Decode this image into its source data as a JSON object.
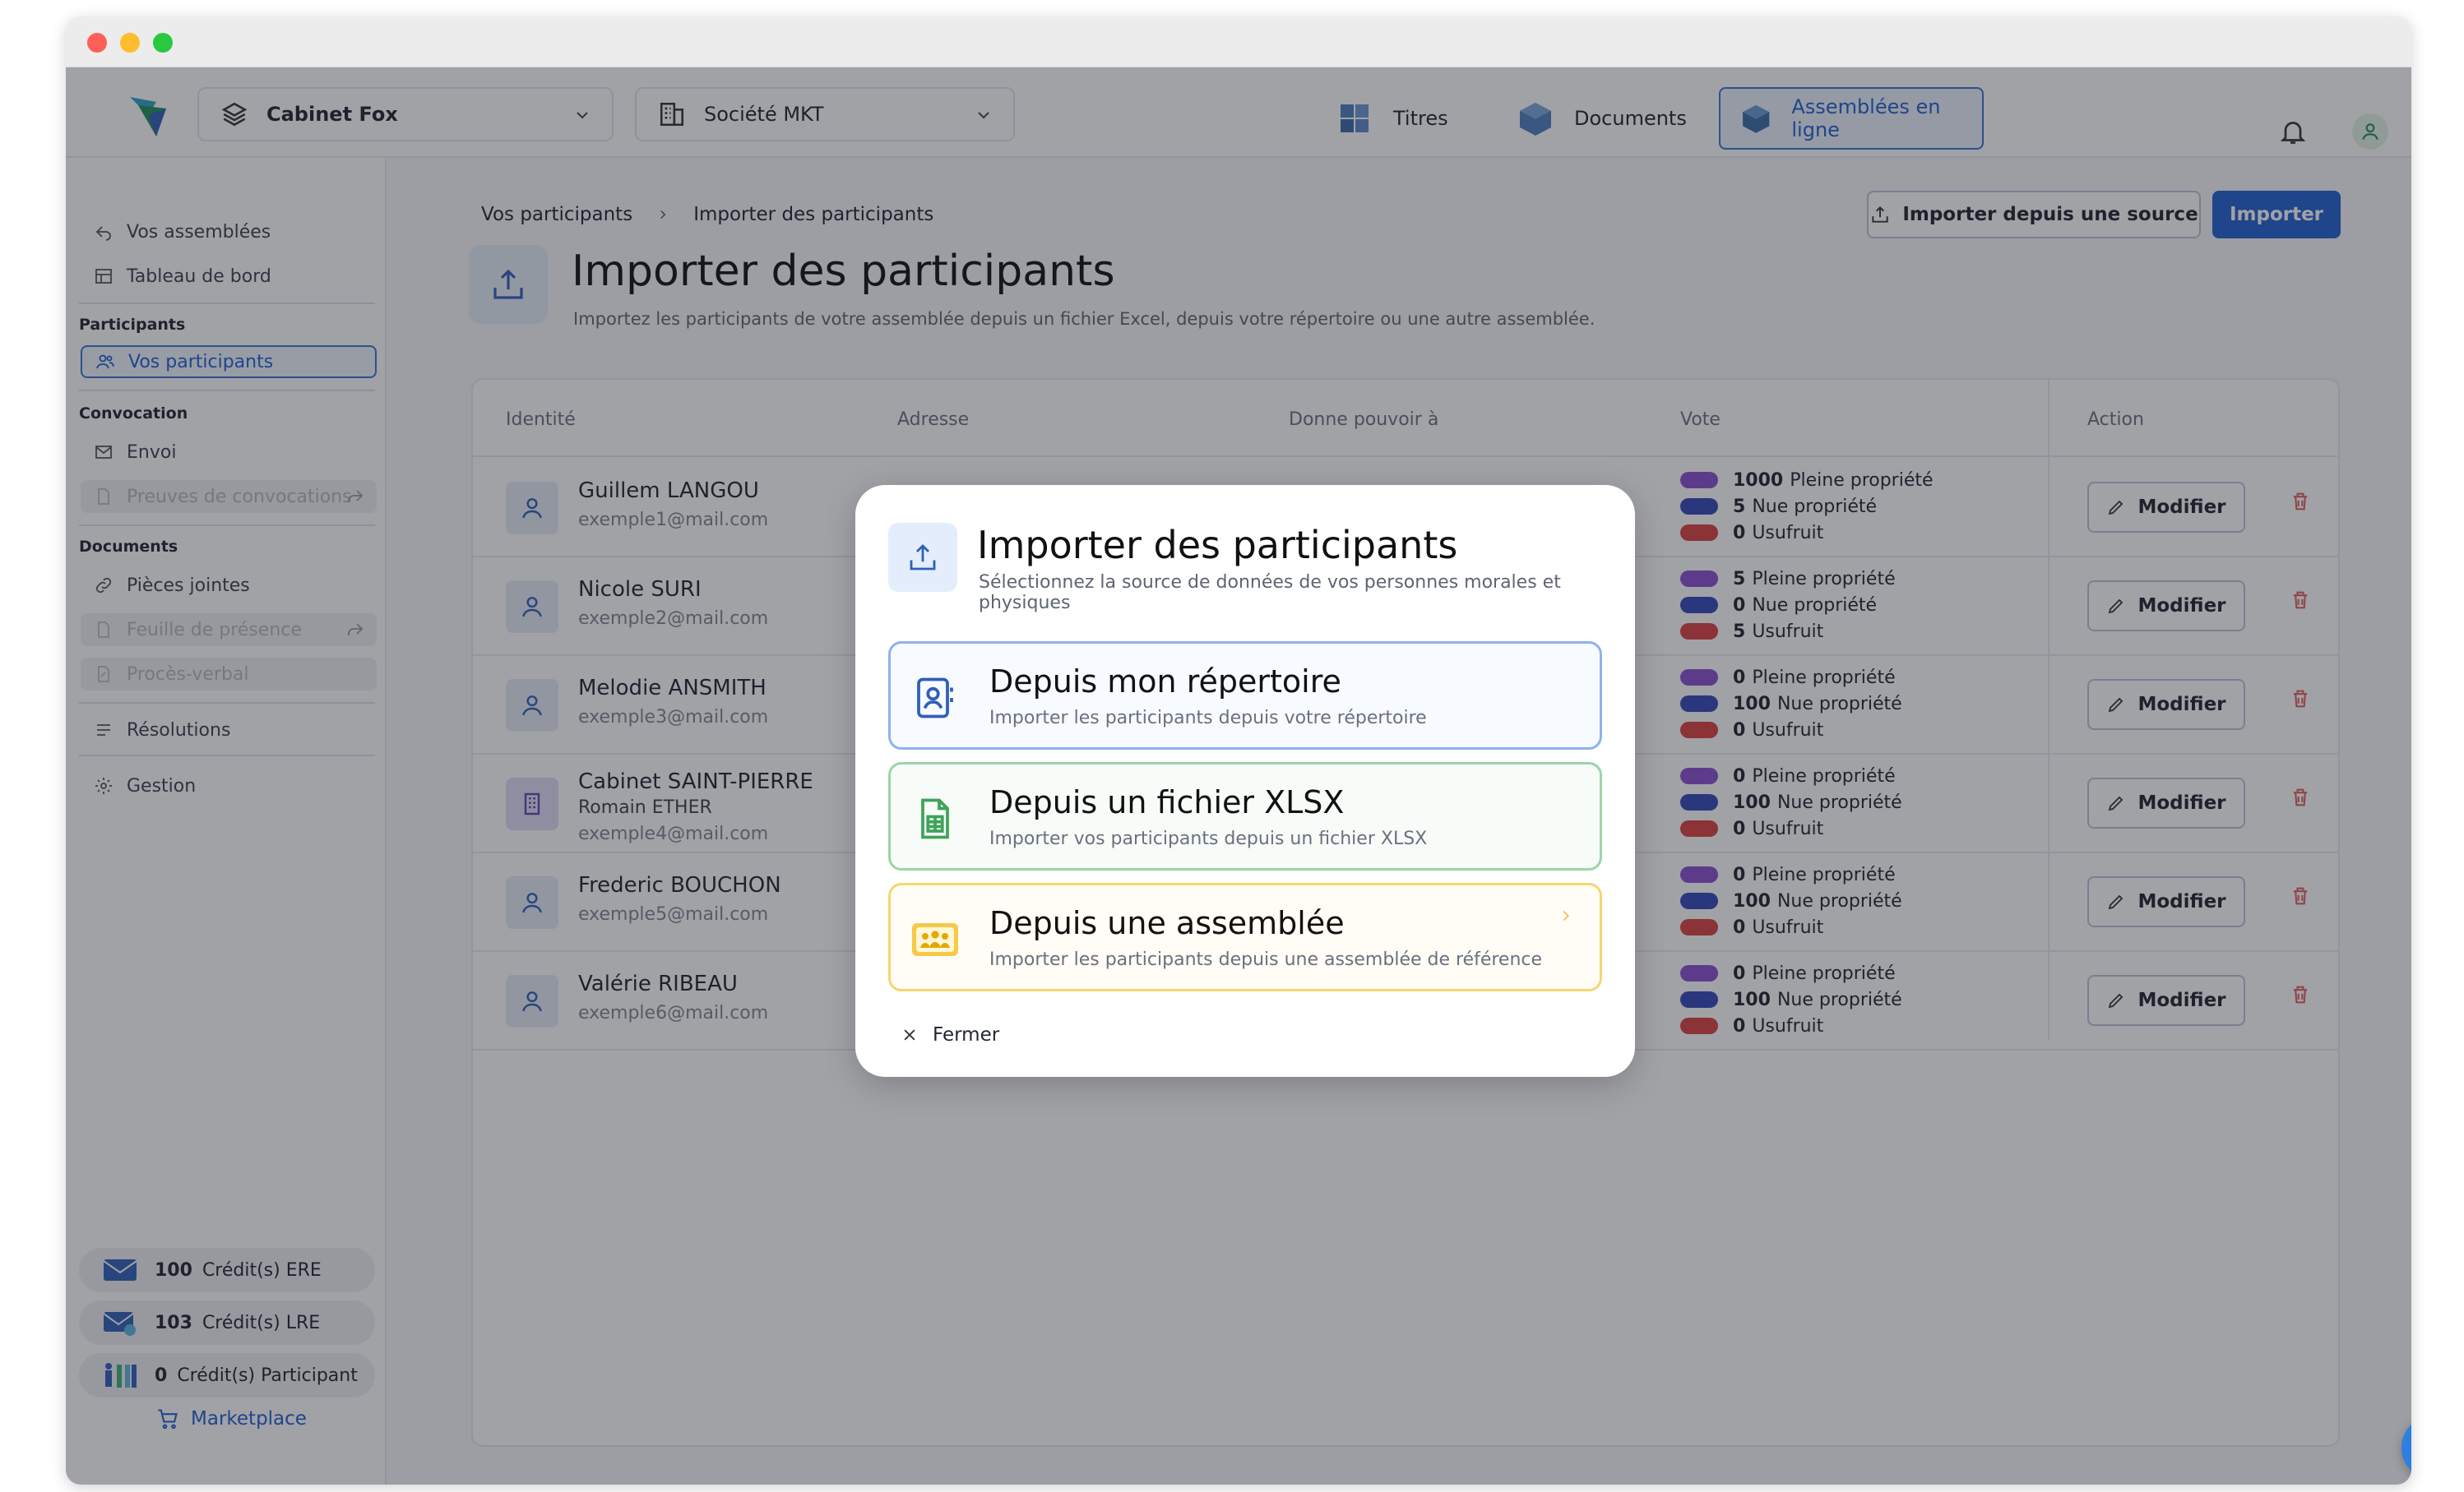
{
  "header": {
    "cabinet_selector": "Cabinet Fox",
    "societe_selector": "Société MKT",
    "nav": [
      {
        "label": "Titres"
      },
      {
        "label": "Documents"
      },
      {
        "label": "Assemblées en ligne",
        "active": true
      }
    ]
  },
  "sidebar": {
    "top_items": [
      "Vos assemblées",
      "Tableau de bord"
    ],
    "sections": [
      {
        "title": "Participants",
        "items": [
          "Vos participants"
        ]
      },
      {
        "title": "Convocation",
        "items": [
          "Envoi",
          "Preuves de convocations"
        ]
      },
      {
        "title": "Documents",
        "items": [
          "Pièces jointes",
          "Feuille de présence",
          "Procès-verbal"
        ]
      }
    ],
    "bottom_items": [
      "Résolutions",
      "Gestion"
    ],
    "credits": [
      {
        "count": "100",
        "label": "Crédit(s) ERE"
      },
      {
        "count": "103",
        "label": "Crédit(s) LRE"
      },
      {
        "count": "0",
        "label": "Crédit(s) Participant"
      }
    ],
    "marketplace": "Marketplace"
  },
  "breadcrumb": {
    "parent": "Vos participants",
    "current": "Importer des participants"
  },
  "page": {
    "title": "Importer des participants",
    "subtitle": "Importez les participants de votre assemblée depuis un fichier Excel, depuis votre répertoire ou une autre assemblée.",
    "btn_source": "Importer depuis une source",
    "btn_import": "Importer"
  },
  "table": {
    "columns": [
      "Identité",
      "Adresse",
      "Donne pouvoir à",
      "Vote",
      "Action"
    ],
    "action_label": "Modifier",
    "vote_labels": [
      "Pleine propriété",
      "Nue propriété",
      "Usufruit"
    ],
    "rows": [
      {
        "name": "Guillem LANGOU",
        "sub": "",
        "email": "exemple1@mail.com",
        "votes": [
          "1000",
          "5",
          "0"
        ]
      },
      {
        "name": "Nicole SURI",
        "sub": "",
        "email": "exemple2@mail.com",
        "votes": [
          "5",
          "0",
          "5"
        ]
      },
      {
        "name": "Melodie ANSMITH",
        "sub": "",
        "email": "exemple3@mail.com",
        "votes": [
          "0",
          "100",
          "0"
        ]
      },
      {
        "name": "Cabinet SAINT-PIERRE",
        "sub": "Romain ETHER",
        "email": "exemple4@mail.com",
        "votes": [
          "0",
          "100",
          "0"
        ]
      },
      {
        "name": "Frederic BOUCHON",
        "sub": "",
        "email": "exemple5@mail.com",
        "votes": [
          "0",
          "100",
          "0"
        ]
      },
      {
        "name": "Valérie RIBEAU",
        "sub": "",
        "email": "exemple6@mail.com",
        "votes": [
          "0",
          "100",
          "0"
        ]
      }
    ]
  },
  "modal": {
    "title": "Importer des participants",
    "subtitle": "Sélectionnez la source de données de vos personnes morales et physiques",
    "options": [
      {
        "title": "Depuis mon répertoire",
        "subtitle": "Importer les participants depuis votre répertoire"
      },
      {
        "title": "Depuis un fichier XLSX",
        "subtitle": "Importer vos participants depuis un fichier XLSX"
      },
      {
        "title": "Depuis une assemblée",
        "subtitle": "Importer les participants depuis une assemblée de référence"
      }
    ],
    "close_label": "Fermer"
  },
  "colors": {
    "primary": "#1f5fcf",
    "pleine": "#8b4fd0",
    "nue": "#3548b8",
    "usufruit": "#d94040"
  }
}
